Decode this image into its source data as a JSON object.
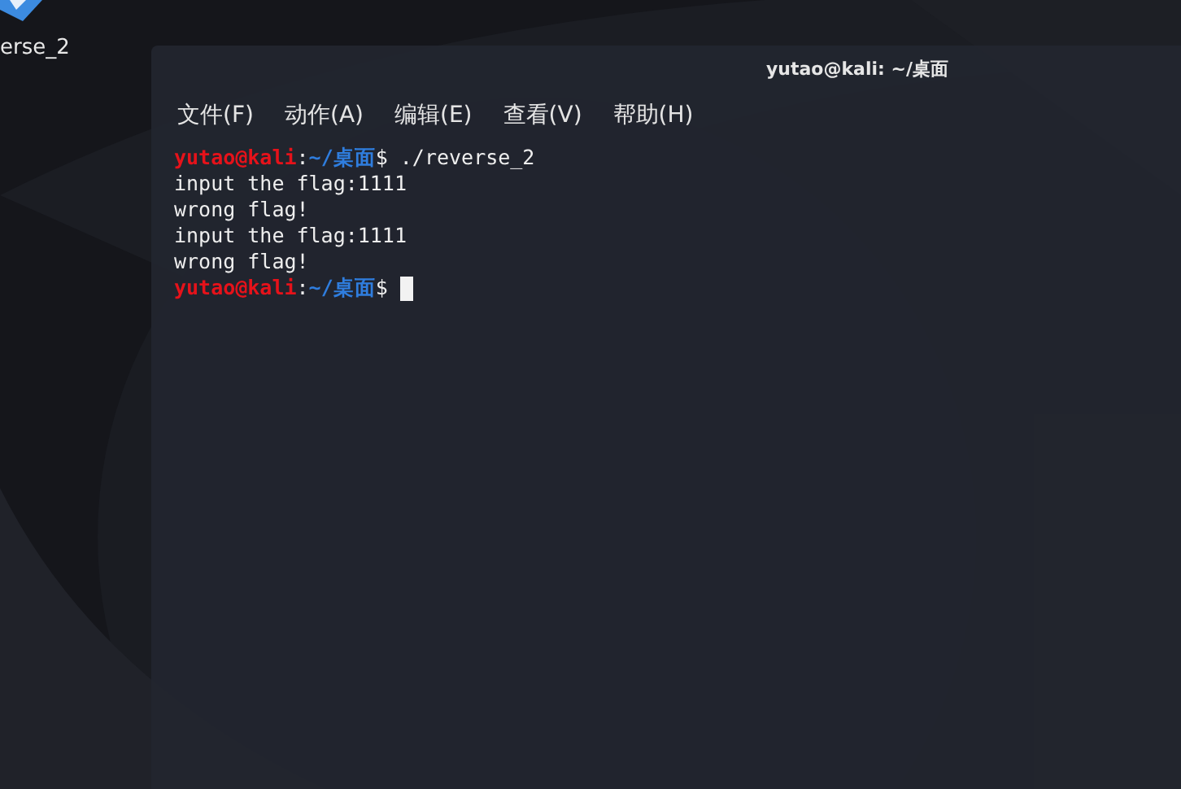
{
  "desktop": {
    "icon_label": "erse_2"
  },
  "window": {
    "title": "yutao@kali: ~/桌面"
  },
  "menu": [
    "文件(F)",
    "动作(A)",
    "编辑(E)",
    "查看(V)",
    "帮助(H)"
  ],
  "terminal": {
    "lines": [
      {
        "segments": [
          {
            "kind": "user",
            "text": "yutao@kali"
          },
          {
            "kind": "plain",
            "text": ":"
          },
          {
            "kind": "path",
            "text": "~/桌面"
          },
          {
            "kind": "plain",
            "text": "$ ./reverse_2"
          }
        ],
        "cursor": false
      },
      {
        "segments": [
          {
            "kind": "plain",
            "text": "input the flag:1111"
          }
        ],
        "cursor": false
      },
      {
        "segments": [
          {
            "kind": "plain",
            "text": "wrong flag!"
          }
        ],
        "cursor": false
      },
      {
        "segments": [
          {
            "kind": "plain",
            "text": "input the flag:1111"
          }
        ],
        "cursor": false
      },
      {
        "segments": [
          {
            "kind": "plain",
            "text": "wrong flag!"
          }
        ],
        "cursor": false
      },
      {
        "segments": [
          {
            "kind": "user",
            "text": "yutao@kali"
          },
          {
            "kind": "plain",
            "text": ":"
          },
          {
            "kind": "path",
            "text": "~/桌面"
          },
          {
            "kind": "plain",
            "text": "$ "
          }
        ],
        "cursor": true
      }
    ]
  }
}
